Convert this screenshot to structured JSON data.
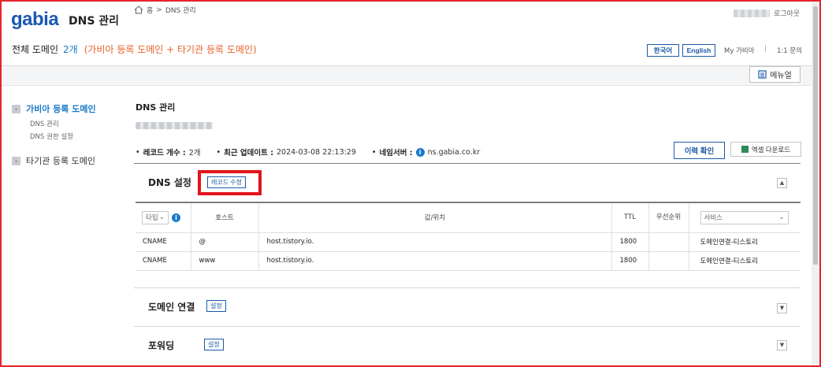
{
  "header": {
    "logo": "gabia",
    "app_title": "DNS 관리",
    "logout": "로그아웃",
    "domain_label": "전체 도메인",
    "domain_count": "2개",
    "domain_hint": "(가비아 등록 도메인 + 타기관 등록 도메인)",
    "lang_ko": "한국어",
    "lang_en": "English",
    "my_gabia": "My 가비아",
    "inquiry": "1:1 문의"
  },
  "breadcrumb": {
    "home": "홈",
    "sep": ">",
    "current": "DNS 관리",
    "manual": "메뉴얼"
  },
  "sidebar": {
    "gabia": {
      "label": "가비아 등록 도메인",
      "subs": [
        "DNS 관리",
        "DNS 권한 설정"
      ]
    },
    "other": {
      "label": "타기관 등록 도메인"
    }
  },
  "main": {
    "title": "DNS 관리",
    "record_count_label": "레코드 개수 :",
    "record_count": "2개",
    "updated_label": "최근 업데이트 :",
    "updated": "2024-03-08 22:13:29",
    "ns_label": "네임서버 :",
    "ns": "ns.gabia.co.kr",
    "history_button": "이력 확인",
    "excel_button": "엑셀 다운로드",
    "dns_section": {
      "title": "DNS 설정",
      "button": "레코드 수정"
    },
    "connect_section": {
      "title": "도메인 연결",
      "button": "설정"
    },
    "forward_section": {
      "title": "포워딩",
      "button": "설정"
    }
  },
  "table": {
    "type_filter": "타입",
    "headers": {
      "host": "호스트",
      "value": "값/위치",
      "ttl": "TTL",
      "priority": "우선순위",
      "service": "서비스"
    },
    "rows": [
      {
        "type": "CNAME",
        "host": "@",
        "value": "host.tistory.io.",
        "ttl": "1800",
        "priority": "",
        "service": "도메인연결-티스토리"
      },
      {
        "type": "CNAME",
        "host": "www",
        "value": "host.tistory.io.",
        "ttl": "1800",
        "priority": "",
        "service": "도메인연결-티스토리"
      }
    ]
  },
  "colors": {
    "accent": "#1b79c9",
    "brand": "#1b57b3",
    "hint": "#e8632b",
    "highlight": "#e3141b"
  },
  "icons": [
    "home-icon",
    "manual-icon",
    "info-icon",
    "excel-icon",
    "chevron-down-icon",
    "collapse-up-icon",
    "expand-down-icon",
    "sidebar-arrow-icon"
  ]
}
